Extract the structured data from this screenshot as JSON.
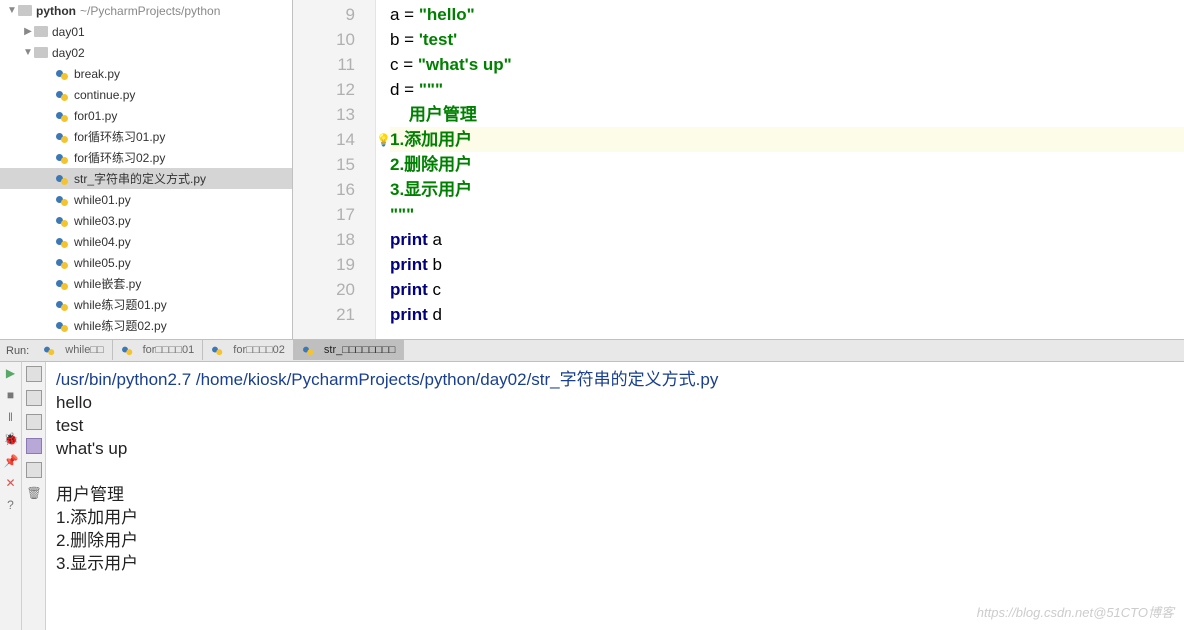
{
  "project": {
    "name": "python",
    "path": "~/PycharmProjects/python"
  },
  "tree": {
    "folders": [
      "day01",
      "day02"
    ],
    "files": [
      "break.py",
      "continue.py",
      "for01.py",
      "for循环练习01.py",
      "for循环练习02.py",
      "str_字符串的定义方式.py",
      "while01.py",
      "while03.py",
      "while04.py",
      "while05.py",
      "while嵌套.py",
      "while练习题01.py",
      "while练习题02.py"
    ],
    "selectedIndex": 5
  },
  "editor": {
    "startLine": 9,
    "lines": [
      {
        "pre": "a = ",
        "str": "\"hello\""
      },
      {
        "pre": "b = ",
        "str": "'test'"
      },
      {
        "pre": "c = ",
        "str": "\"what's up\""
      },
      {
        "pre": "d = ",
        "str": "\"\"\""
      },
      {
        "pre": "",
        "str": "    用户管理"
      },
      {
        "pre": "",
        "str": "1.添加用户",
        "hl": true
      },
      {
        "pre": "",
        "str": "2.删除用户"
      },
      {
        "pre": "",
        "str": "3.显示用户"
      },
      {
        "pre": "",
        "str": "\"\"\""
      },
      {
        "kw": "print",
        "post": " a"
      },
      {
        "kw": "print",
        "post": " b"
      },
      {
        "kw": "print",
        "post": " c"
      },
      {
        "kw": "print",
        "post": " d"
      }
    ],
    "bulb": "💡"
  },
  "run": {
    "label": "Run:",
    "tabs": [
      "while□□",
      "for□□□□01",
      "for□□□□02",
      "str_□□□□□□□□"
    ],
    "activeTab": 3
  },
  "console": {
    "command": "/usr/bin/python2.7 /home/kiosk/PycharmProjects/python/day02/str_字符串的定义方式.py",
    "output": [
      "hello",
      "test",
      "what's up",
      "",
      "    用户管理",
      "1.添加用户",
      "2.删除用户",
      "3.显示用户"
    ]
  },
  "watermark": "https://blog.csdn.net@51CTO博客"
}
